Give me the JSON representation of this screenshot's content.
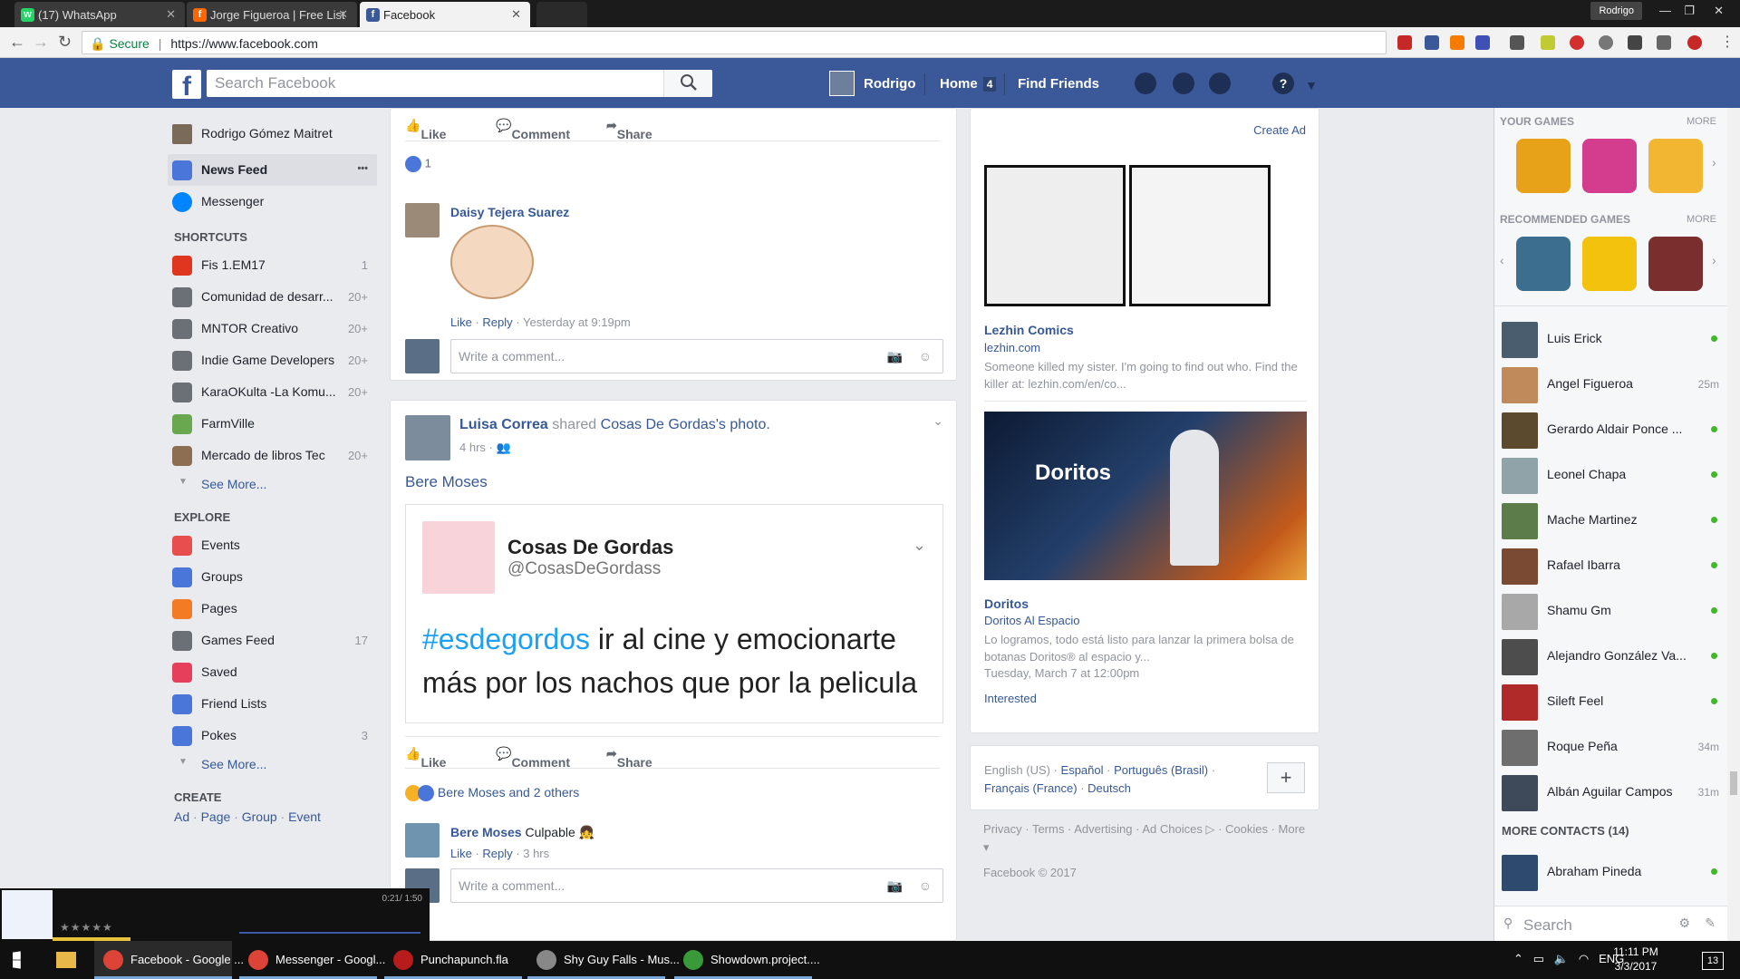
{
  "browser": {
    "tabs": [
      {
        "label": "(17) WhatsApp",
        "color": "#25d366"
      },
      {
        "label": "Jorge Figueroa | Free List",
        "color": "#f60"
      },
      {
        "label": "Facebook",
        "color": "#3b5998"
      }
    ],
    "profile": "Rodrigo",
    "secure": "Secure",
    "url": "https://www.facebook.com"
  },
  "fb_header": {
    "logo": "f",
    "search_placeholder": "Search Facebook",
    "user": "Rodrigo",
    "home_label": "Home",
    "home_count": "4",
    "find_friends": "Find Friends",
    "help": "?"
  },
  "left_nav": {
    "profile_name": "Rodrigo Gómez Maitret",
    "news_feed": "News Feed",
    "more_dots": "•••",
    "messenger": "Messenger",
    "shortcuts_title": "SHORTCUTS",
    "shortcuts": [
      {
        "label": "Fis 1.EM17",
        "count": "1",
        "color": "#e0361f"
      },
      {
        "label": "Comunidad de desarr...",
        "count": "20+",
        "color": "#6b6f76"
      },
      {
        "label": "MNTOR Creativo",
        "count": "20+",
        "color": "#6b6f76"
      },
      {
        "label": "Indie Game Developers",
        "count": "20+",
        "color": "#6b6f76"
      },
      {
        "label": "KaraOKulta -La Komu...",
        "count": "20+",
        "color": "#6b6f76"
      },
      {
        "label": "FarmVille",
        "count": "",
        "color": "#6aa84f"
      },
      {
        "label": "Mercado de libros Tec",
        "count": "20+",
        "color": "#8e6e53"
      }
    ],
    "see_more": "See More...",
    "explore_title": "EXPLORE",
    "explore": [
      {
        "label": "Events",
        "count": "",
        "color": "#e94e4e"
      },
      {
        "label": "Groups",
        "count": "",
        "color": "#4a76d9"
      },
      {
        "label": "Pages",
        "count": "",
        "color": "#f27b24"
      },
      {
        "label": "Games Feed",
        "count": "17",
        "color": "#6b6f76"
      },
      {
        "label": "Saved",
        "count": "",
        "color": "#e63f5c"
      },
      {
        "label": "Friend Lists",
        "count": "",
        "color": "#4a76d9"
      },
      {
        "label": "Pokes",
        "count": "3",
        "color": "#4a76d9"
      }
    ],
    "see_more2": "See More...",
    "create_title": "CREATE",
    "create_links": [
      "Ad",
      "Page",
      "Group",
      "Event"
    ]
  },
  "post1": {
    "like": "Like",
    "comment": "Comment",
    "share": "Share",
    "reactions_count": "1",
    "commenter": "Daisy Tejera Suarez",
    "comment_like": "Like",
    "comment_reply": "Reply",
    "comment_time": "Yesterday at 9:19pm",
    "write_comment": "Write a comment..."
  },
  "post2": {
    "author": "Luisa Correa",
    "shared_text": "shared",
    "shared_page": "Cosas De Gordas",
    "shared_suffix": "'s",
    "photo": "photo.",
    "time": "4 hrs",
    "tag": "Bere Moses",
    "tweet_name": "Cosas De Gordas",
    "tweet_handle": "@CosasDeGordass",
    "tweet_hashtag": "#esdegordos",
    "tweet_text1": " ir al cine y emocionarte",
    "tweet_text2": "más por los nachos que por la pelicula",
    "like": "Like",
    "comment": "Comment",
    "share": "Share",
    "reactions": "Bere Moses and 2 others",
    "commenter": "Bere Moses",
    "comment_text": "Culpable",
    "comment_like": "Like",
    "comment_reply": "Reply",
    "comment_time": "3 hrs",
    "write_comment": "Write a comment..."
  },
  "ads": {
    "create_ad": "Create Ad",
    "ad1_title": "Lezhin Comics",
    "ad1_domain": "lezhin.com",
    "ad1_text": "Someone killed my sister. I'm going to find out who. Find the killer at: lezhin.com/en/co...",
    "ad2_image_text": "Doritos",
    "ad2_title": "Doritos",
    "ad2_sub": "Doritos Al Espacio",
    "ad2_text": "Lo logramos, todo está listo para lanzar la primera bolsa de botanas Doritos® al espacio y...",
    "ad2_date": "Tuesday, March 7 at 12:00pm",
    "ad2_interested": "Interested"
  },
  "languages": {
    "current": "English (US)",
    "others": [
      "Español",
      "Português (Brasil)",
      "Français (France)",
      "Deutsch"
    ],
    "plus": "+"
  },
  "footer": {
    "links": [
      "Privacy",
      "Terms",
      "Advertising",
      "Ad Choices",
      "Cookies",
      "More"
    ],
    "copyright": "Facebook © 2017"
  },
  "games": {
    "your_games": "YOUR GAMES",
    "more": "MORE",
    "recommended": "RECOMMENDED GAMES",
    "your_colors": [
      "#e8a21a",
      "#d43c8e",
      "#f2b632"
    ],
    "rec_colors": [
      "#3c6e8f",
      "#f2c20c",
      "#7b2e2e"
    ]
  },
  "chat": {
    "contacts": [
      {
        "name": "Luis Erick",
        "status": "online",
        "color": "#4a5d6e"
      },
      {
        "name": "Angel Figueroa",
        "status": "25m",
        "color": "#c08a5a"
      },
      {
        "name": "Gerardo Aldair Ponce ...",
        "status": "online",
        "color": "#5b4a2e"
      },
      {
        "name": "Leonel Chapa",
        "status": "online",
        "color": "#8fa3a8"
      },
      {
        "name": "Mache Martinez",
        "status": "online",
        "color": "#5c7d4a"
      },
      {
        "name": "Rafael Ibarra",
        "status": "online",
        "color": "#7a4a32"
      },
      {
        "name": "Shamu Gm",
        "status": "online",
        "color": "#a8a8a8"
      },
      {
        "name": "Alejandro González Va...",
        "status": "online",
        "color": "#4d4d4d"
      },
      {
        "name": "Sileft Feel",
        "status": "online",
        "color": "#b02a2a"
      },
      {
        "name": "Roque Peña",
        "status": "34m",
        "color": "#6e6e6e"
      },
      {
        "name": "Albán Aguilar Campos",
        "status": "31m",
        "color": "#3e4a5a"
      }
    ],
    "more_contacts": "MORE CONTACTS (14)",
    "extra_contact": {
      "name": "Abraham Pineda",
      "status": "online",
      "color": "#2e4a6e"
    },
    "search": "Search"
  },
  "media": {
    "time": "0:21/ 1:50"
  },
  "taskbar": {
    "tasks": [
      {
        "label": "Facebook - Google ...",
        "color": "#db4437"
      },
      {
        "label": "Messenger - Googl...",
        "color": "#db4437"
      },
      {
        "label": "Punchapunch.fla",
        "color": "#b71c1c"
      },
      {
        "label": "Shy Guy Falls - Mus...",
        "color": "#888"
      },
      {
        "label": "Showdown.project....",
        "color": "#3a9a3a"
      }
    ],
    "lang": "ENG",
    "time": "11:11 PM",
    "date": "3/3/2017",
    "notif": "13"
  }
}
